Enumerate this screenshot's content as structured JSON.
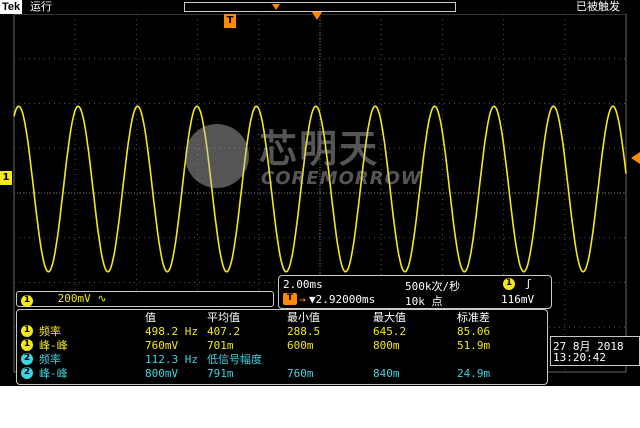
{
  "header": {
    "brand": "Tek",
    "run_state": "运行",
    "trigger_state": "已被触发"
  },
  "markers": {
    "ch1_label": "1",
    "trigger_pos_label": "T"
  },
  "watermark": {
    "title": "芯明天",
    "subtitle": "COREMORROW"
  },
  "horizontal": {
    "timebase": "2.00ms",
    "sample_rate": "500k次/秒",
    "delay": "▼2.92000ms",
    "record_length": "10k 点",
    "trigger_source": "1",
    "trigger_slope": "ʃ",
    "trigger_level": "116mV"
  },
  "channel1": {
    "label": "1",
    "scale": "200mV ∿"
  },
  "measurements": {
    "headers": [
      "值",
      "平均值",
      "最小值",
      "最大值",
      "标准差"
    ],
    "rows": [
      {
        "channel": "1",
        "color": "yellow",
        "name": "频率",
        "value": "498.2 Hz",
        "mean": "407.2",
        "min": "288.5",
        "max": "645.2",
        "std": "85.06"
      },
      {
        "channel": "1",
        "color": "yellow",
        "name": "峰-峰",
        "value": "760mV",
        "mean": "701m",
        "min": "600m",
        "max": "800m",
        "std": "51.9m"
      },
      {
        "channel": "2",
        "color": "cyan",
        "name": "频率",
        "value": "112.3 Hz",
        "mean": "低信号幅度",
        "min": "",
        "max": "",
        "std": ""
      },
      {
        "channel": "2",
        "color": "cyan",
        "name": "峰-峰",
        "value": "800mV",
        "mean": "791m",
        "min": "760m",
        "max": "840m",
        "std": "24.9m"
      }
    ]
  },
  "datetime": {
    "date": "27 8月  2018",
    "time": "13:20:42"
  },
  "waveform": {
    "cycles": 10.3,
    "color": "#f4e81c"
  }
}
